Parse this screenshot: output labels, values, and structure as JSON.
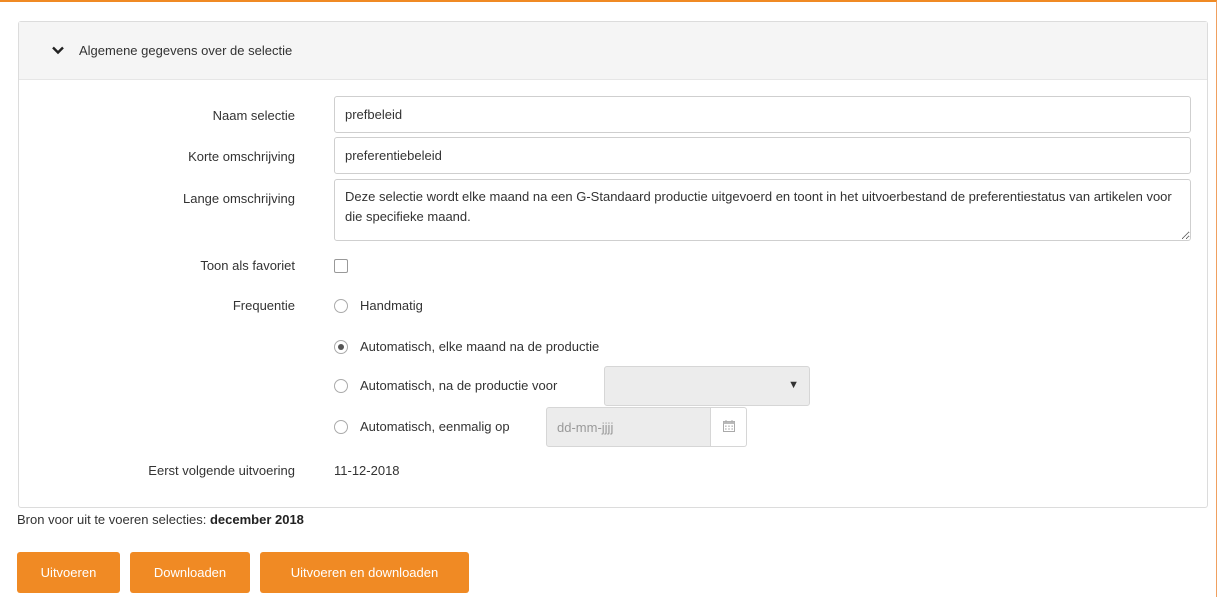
{
  "panel": {
    "title": "Algemene gegevens over de selectie"
  },
  "form": {
    "naam": {
      "label": "Naam selectie",
      "value": "prefbeleid"
    },
    "korte": {
      "label": "Korte omschrijving",
      "value": "preferentiebeleid"
    },
    "lange": {
      "label": "Lange omschrijving",
      "value": "Deze selectie wordt elke maand na een G-Standaard productie uitgevoerd en toont in het uitvoerbestand de preferentiestatus van artikelen voor die specifieke maand."
    },
    "favoriet": {
      "label": "Toon als favoriet",
      "checked": false
    },
    "frequentie": {
      "label": "Frequentie",
      "options": [
        {
          "label": "Handmatig",
          "checked": false
        },
        {
          "label": "Automatisch, elke maand na de productie",
          "checked": true
        },
        {
          "label": "Automatisch, na de productie voor",
          "checked": false
        },
        {
          "label": "Automatisch, eenmalig op",
          "checked": false
        }
      ],
      "date_placeholder": "dd-mm-jjjj"
    },
    "volgende": {
      "label": "Eerst volgende uitvoering",
      "value": "11-12-2018"
    }
  },
  "bron": {
    "prefix": "Bron voor uit te voeren selecties:",
    "value": "december 2018"
  },
  "buttons": {
    "uitvoeren": "Uitvoeren",
    "downloaden": "Downloaden",
    "uitvoeren_downloaden": "Uitvoeren en downloaden"
  },
  "colors": {
    "accent": "#f08a24"
  }
}
